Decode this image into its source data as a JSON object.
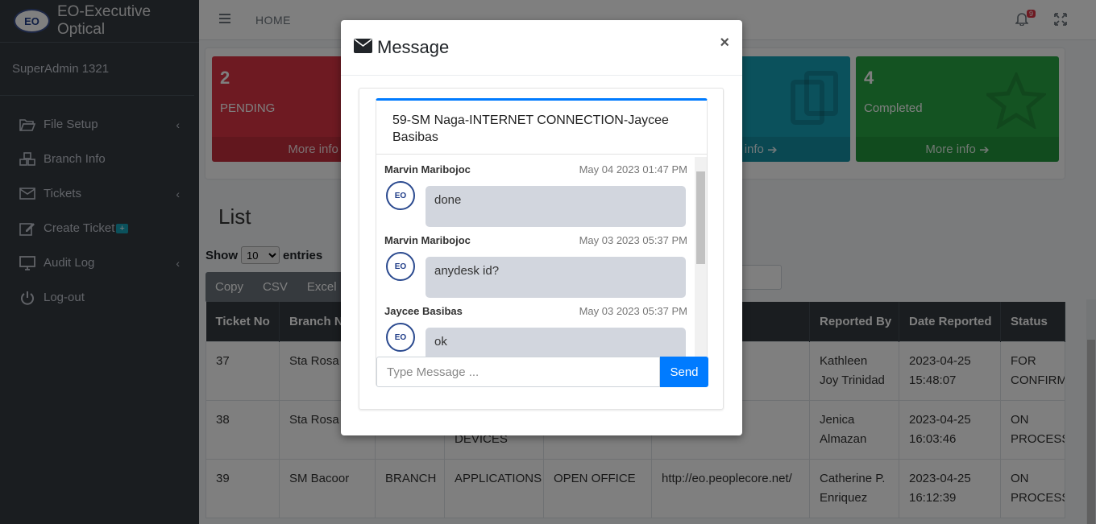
{
  "brand": {
    "logo_text": "EO",
    "name": "EO-Executive Optical"
  },
  "user": {
    "name": "SuperAdmin 1321"
  },
  "sidebar": {
    "items": [
      {
        "label": "File Setup",
        "icon": "folder-open-icon",
        "has_arrow": true
      },
      {
        "label": "Branch Info",
        "icon": "cubes-icon",
        "has_arrow": false
      },
      {
        "label": "Tickets",
        "icon": "envelope-icon",
        "has_arrow": true
      },
      {
        "label": "Create Ticket",
        "icon": "edit-icon",
        "has_arrow": false,
        "badge": "+"
      },
      {
        "label": "Audit Log",
        "icon": "monitor-icon",
        "has_arrow": true
      },
      {
        "label": "Log-out",
        "icon": "power-icon",
        "has_arrow": false
      }
    ]
  },
  "topbar": {
    "home_label": "HOME",
    "notif_count": "9"
  },
  "stats": [
    {
      "count": "2",
      "label": "PENDING",
      "more": "More info",
      "color": "#dc3545"
    },
    {
      "count": "",
      "label": "",
      "more": "More info",
      "color": "#17a2b8"
    },
    {
      "count": "4",
      "label": "Completed",
      "more": "More info",
      "color": "#28a745"
    }
  ],
  "list": {
    "title": "List",
    "show_label": "Show",
    "entries_label": "entries",
    "page_size": "10",
    "buttons": [
      "Copy",
      "CSV",
      "Excel"
    ],
    "columns": [
      "Ticket No",
      "Branch Name",
      "",
      "",
      "",
      "",
      "Reported By",
      "Date Reported",
      "Status"
    ],
    "rows": [
      {
        "ticket": "37",
        "branch": "Sta Rosa",
        "type": "",
        "category": "",
        "sub": "",
        "link": "",
        "reporter": "Kathleen Joy Trinidad",
        "date": "2023-04-25 15:48:07",
        "status": "FOR CONFIRMATION"
      },
      {
        "ticket": "38",
        "branch": "Sta Rosa",
        "type": "",
        "category": "DEVICES",
        "sub": "",
        "link": "",
        "reporter": "Jenica Almazan",
        "date": "2023-04-25 16:03:46",
        "status": "ON PROCESS"
      },
      {
        "ticket": "39",
        "branch": "SM Bacoor",
        "type": "BRANCH",
        "category": "APPLICATIONS",
        "sub": "OPEN OFFICE",
        "link": "http://eo.peoplecore.net/",
        "reporter": "Catherine P. Enriquez",
        "date": "2023-04-25 16:12:39",
        "status": "ON PROCESS"
      }
    ]
  },
  "modal": {
    "title": "Message",
    "close": "×",
    "chat_title": "59-SM Naga-INTERNET CONNECTION-Jaycee Basibas",
    "messages": [
      {
        "sender": "Marvin Maribojoc",
        "time": "May 04 2023 01:47 PM",
        "text": "done",
        "avatar": "EO"
      },
      {
        "sender": "Marvin Maribojoc",
        "time": "May 03 2023 05:37 PM",
        "text": "anydesk id?",
        "avatar": "EO"
      },
      {
        "sender": "Jaycee Basibas",
        "time": "May 03 2023 05:37 PM",
        "text": "ok",
        "avatar": "EO"
      }
    ],
    "input_placeholder": "Type Message ...",
    "send_label": "Send"
  }
}
